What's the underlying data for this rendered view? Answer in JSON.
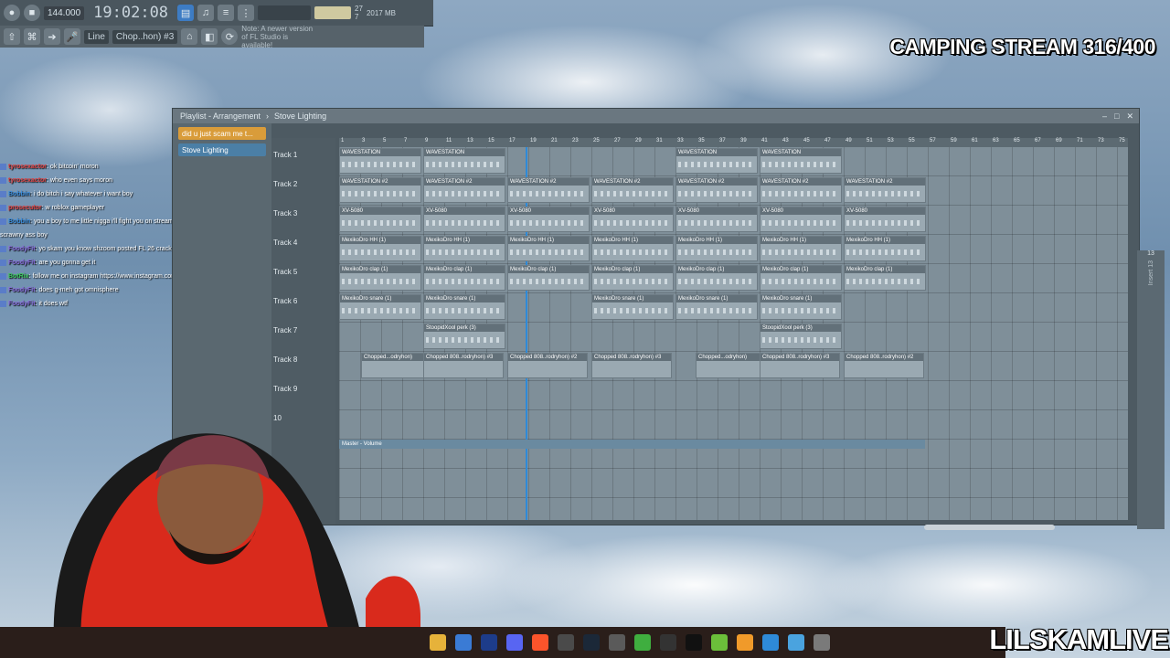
{
  "toolbar": {
    "tempo": "144.000",
    "clock": "19:02:08",
    "cpu_value": "27",
    "memory": "2017 MB",
    "cpu_cores": "7",
    "snap": "Line",
    "pattern": "Chop..hon) #3",
    "update_hint": "Note: A newer version of FL Studio is available!"
  },
  "stream_title": "CAMPING STREAM 316/400",
  "watermark": "LILSKAMLIVE",
  "chat": [
    {
      "user": "tyrosexactor",
      "text": ": ok bitcoin' moron"
    },
    {
      "user": "tyrosexactor",
      "text": ": who even says moron"
    },
    {
      "user": "Bobbin",
      "text": ": i do bitch i say whatever i want boy"
    },
    {
      "user": "prosecutor",
      "text": ": w roblox gameplayer"
    },
    {
      "user": "Bobbin",
      "text": ": you a boy to me little nigga i'll fight you on stream and pay you to lose to me like a bitch you tre"
    },
    {
      "user": "",
      "text": "scrawny ass boy"
    },
    {
      "user": "FoodyFit",
      "text": ": yo skam you know shzoom posted FL 26 cracked version"
    },
    {
      "user": "FoodyFit",
      "text": ": are you gonna get it"
    },
    {
      "user": "BotRix",
      "text": ": follow me on instagram https://www.instagram.com/lilskamz/"
    },
    {
      "user": "FoodyFit",
      "text": ": does g-meh got omnisphere"
    },
    {
      "user": "FoodyFit",
      "text": ": it does wtf"
    }
  ],
  "playlist": {
    "title": "Playlist - Arrangement",
    "pattern_name": "Stove Lighting",
    "left_items": [
      "did u just scam me t...",
      "Stove Lighting"
    ],
    "tracks": [
      "Track 1",
      "Track 2",
      "Track 3",
      "Track 4",
      "Track 5",
      "Track 6",
      "Track 7",
      "Track 8",
      "Track 9",
      "10"
    ],
    "ruler": [
      "1",
      "3",
      "5",
      "7",
      "9",
      "11",
      "13",
      "15",
      "17",
      "19",
      "21",
      "23",
      "25",
      "27",
      "29",
      "31",
      "33",
      "35",
      "37",
      "39",
      "41",
      "43",
      "45",
      "47",
      "49",
      "51",
      "53",
      "55",
      "57",
      "59",
      "61",
      "63",
      "65",
      "67",
      "69",
      "71",
      "73",
      "75"
    ],
    "master_lane": "Master - Volume",
    "clip_names": {
      "t1": "WAVESTATION",
      "t2": "WAVESTATION #2",
      "t3": "XV-5080",
      "t4": "MexikoDro HH (1)",
      "t5": "MexikoDro clap (1)",
      "t6": "MexikoDro snare (1)",
      "t7": "StoopidXool perk (3)",
      "t8a": "Chopped...odryhon)",
      "t8b": "Chopped 808..rodryhon) #3",
      "t8c": "Chopped 808..rodryhon) #2"
    }
  },
  "mixer": {
    "label": "13",
    "insert": "Insert 13"
  },
  "colors": {
    "accent": "#d99c3a",
    "playhead": "#2e8ad8",
    "window": "#4d5a62",
    "grid": "#7f8f99"
  },
  "taskbar_icons": [
    "folder-icon",
    "store-icon",
    "photoshop-icon",
    "discord-icon",
    "brave-icon",
    "obs-icon",
    "steam-icon",
    "app-icon",
    "bandicam-icon",
    "ak-icon",
    "capcut-icon",
    "utorrent-icon",
    "fl-studio-icon",
    "editor-icon",
    "notes-icon",
    "media-player-icon"
  ]
}
